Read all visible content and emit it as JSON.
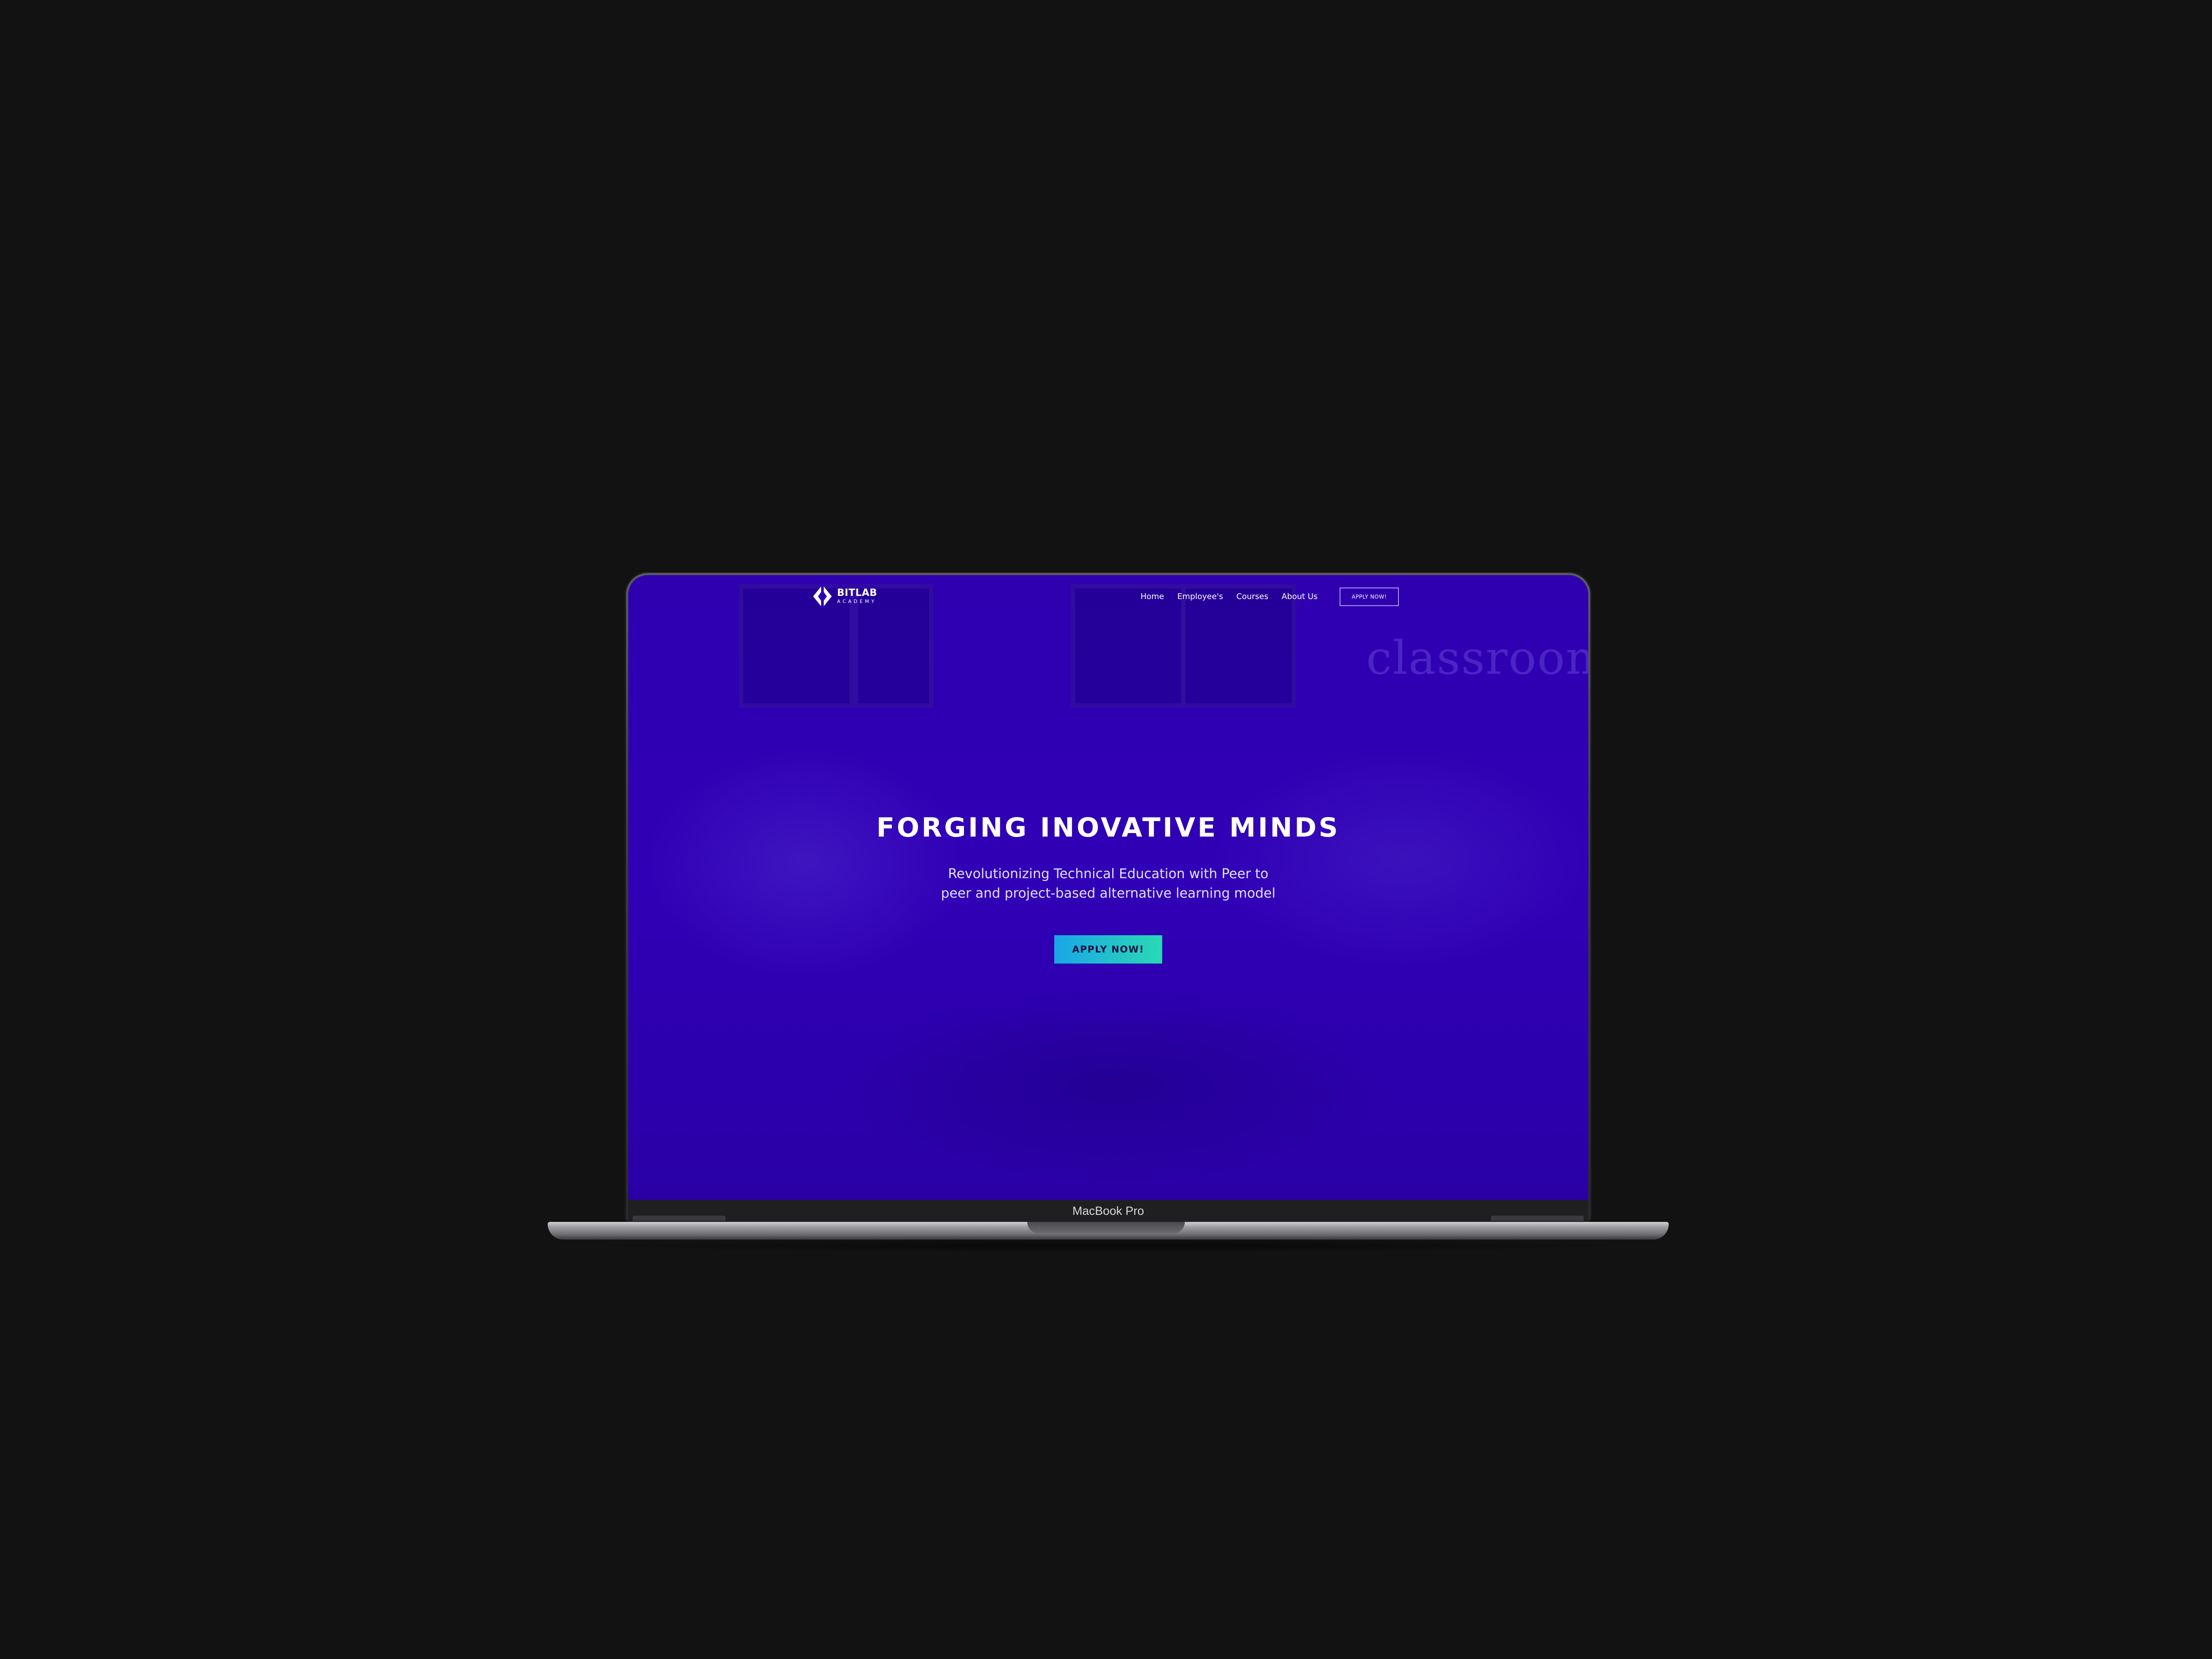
{
  "device": {
    "label": "MacBook Pro"
  },
  "site": {
    "logo": {
      "name": "BITLAB",
      "subtitle": "ACADEMY",
      "icon": "bitlab-diamond-logo"
    },
    "nav": {
      "items": [
        {
          "label": "Home"
        },
        {
          "label": "Employee's"
        },
        {
          "label": "Courses"
        },
        {
          "label": "About Us"
        }
      ],
      "apply_label": "APPLY NOW!"
    },
    "hero": {
      "background_word": "classroom",
      "title": "FORGING INOVATIVE MINDS",
      "subtitle_line1": "Revolutionizing Technical Education with Peer to",
      "subtitle_line2": "peer and project-based alternative learning model",
      "cta_label": "APPLY NOW!"
    }
  },
  "colors": {
    "page_background": "#121212",
    "hero_overlay": "#2f00b4",
    "cta_gradient_start": "#1aa6e6",
    "cta_gradient_end": "#29d9b4",
    "text": "#ffffff"
  }
}
